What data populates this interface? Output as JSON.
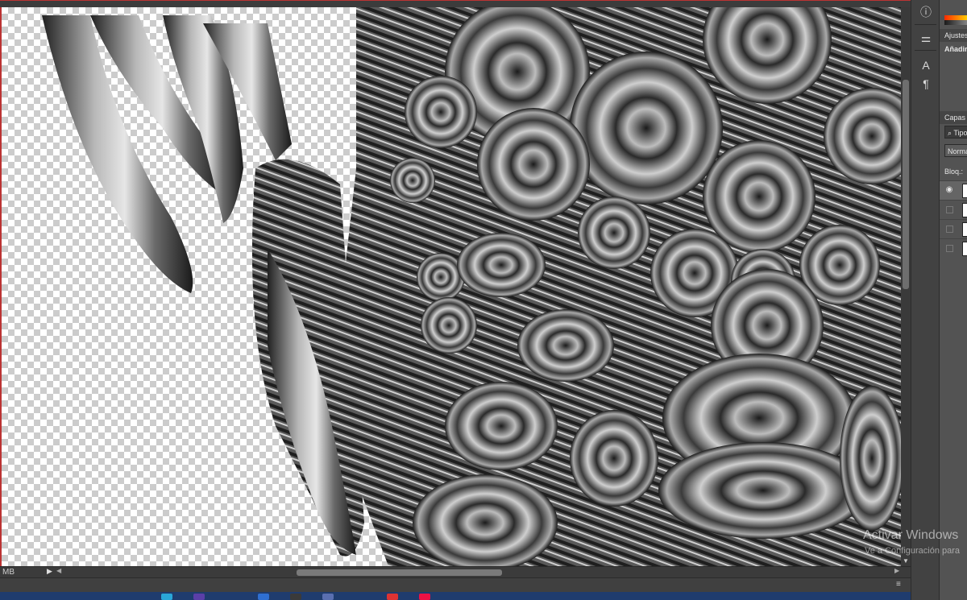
{
  "status": {
    "doc_info": "MB"
  },
  "right_panel": {
    "ajustes_tab": "Ajustes",
    "anadir_label": "Añadir",
    "capas_tab": "Capas",
    "search_value": "Tipo",
    "blend_mode": "Normal",
    "lock_label": "Bloq.:"
  },
  "icon_strip": [
    {
      "name": "info-icon",
      "glyph": "i"
    },
    {
      "name": "properties-icon",
      "glyph": "≡"
    },
    {
      "name": "character-icon",
      "glyph": "A"
    },
    {
      "name": "paragraph-icon",
      "glyph": "¶"
    }
  ],
  "layers": [
    {
      "visible": true
    },
    {
      "visible": false
    },
    {
      "visible": false
    },
    {
      "visible": false
    }
  ],
  "watermark": {
    "title": "Activar Windows",
    "subtitle": "Ve a Configuración para"
  },
  "colors": {
    "accent_red": "#b33333",
    "panel_bg": "#535353",
    "taskbar": "#1f3c6e"
  }
}
